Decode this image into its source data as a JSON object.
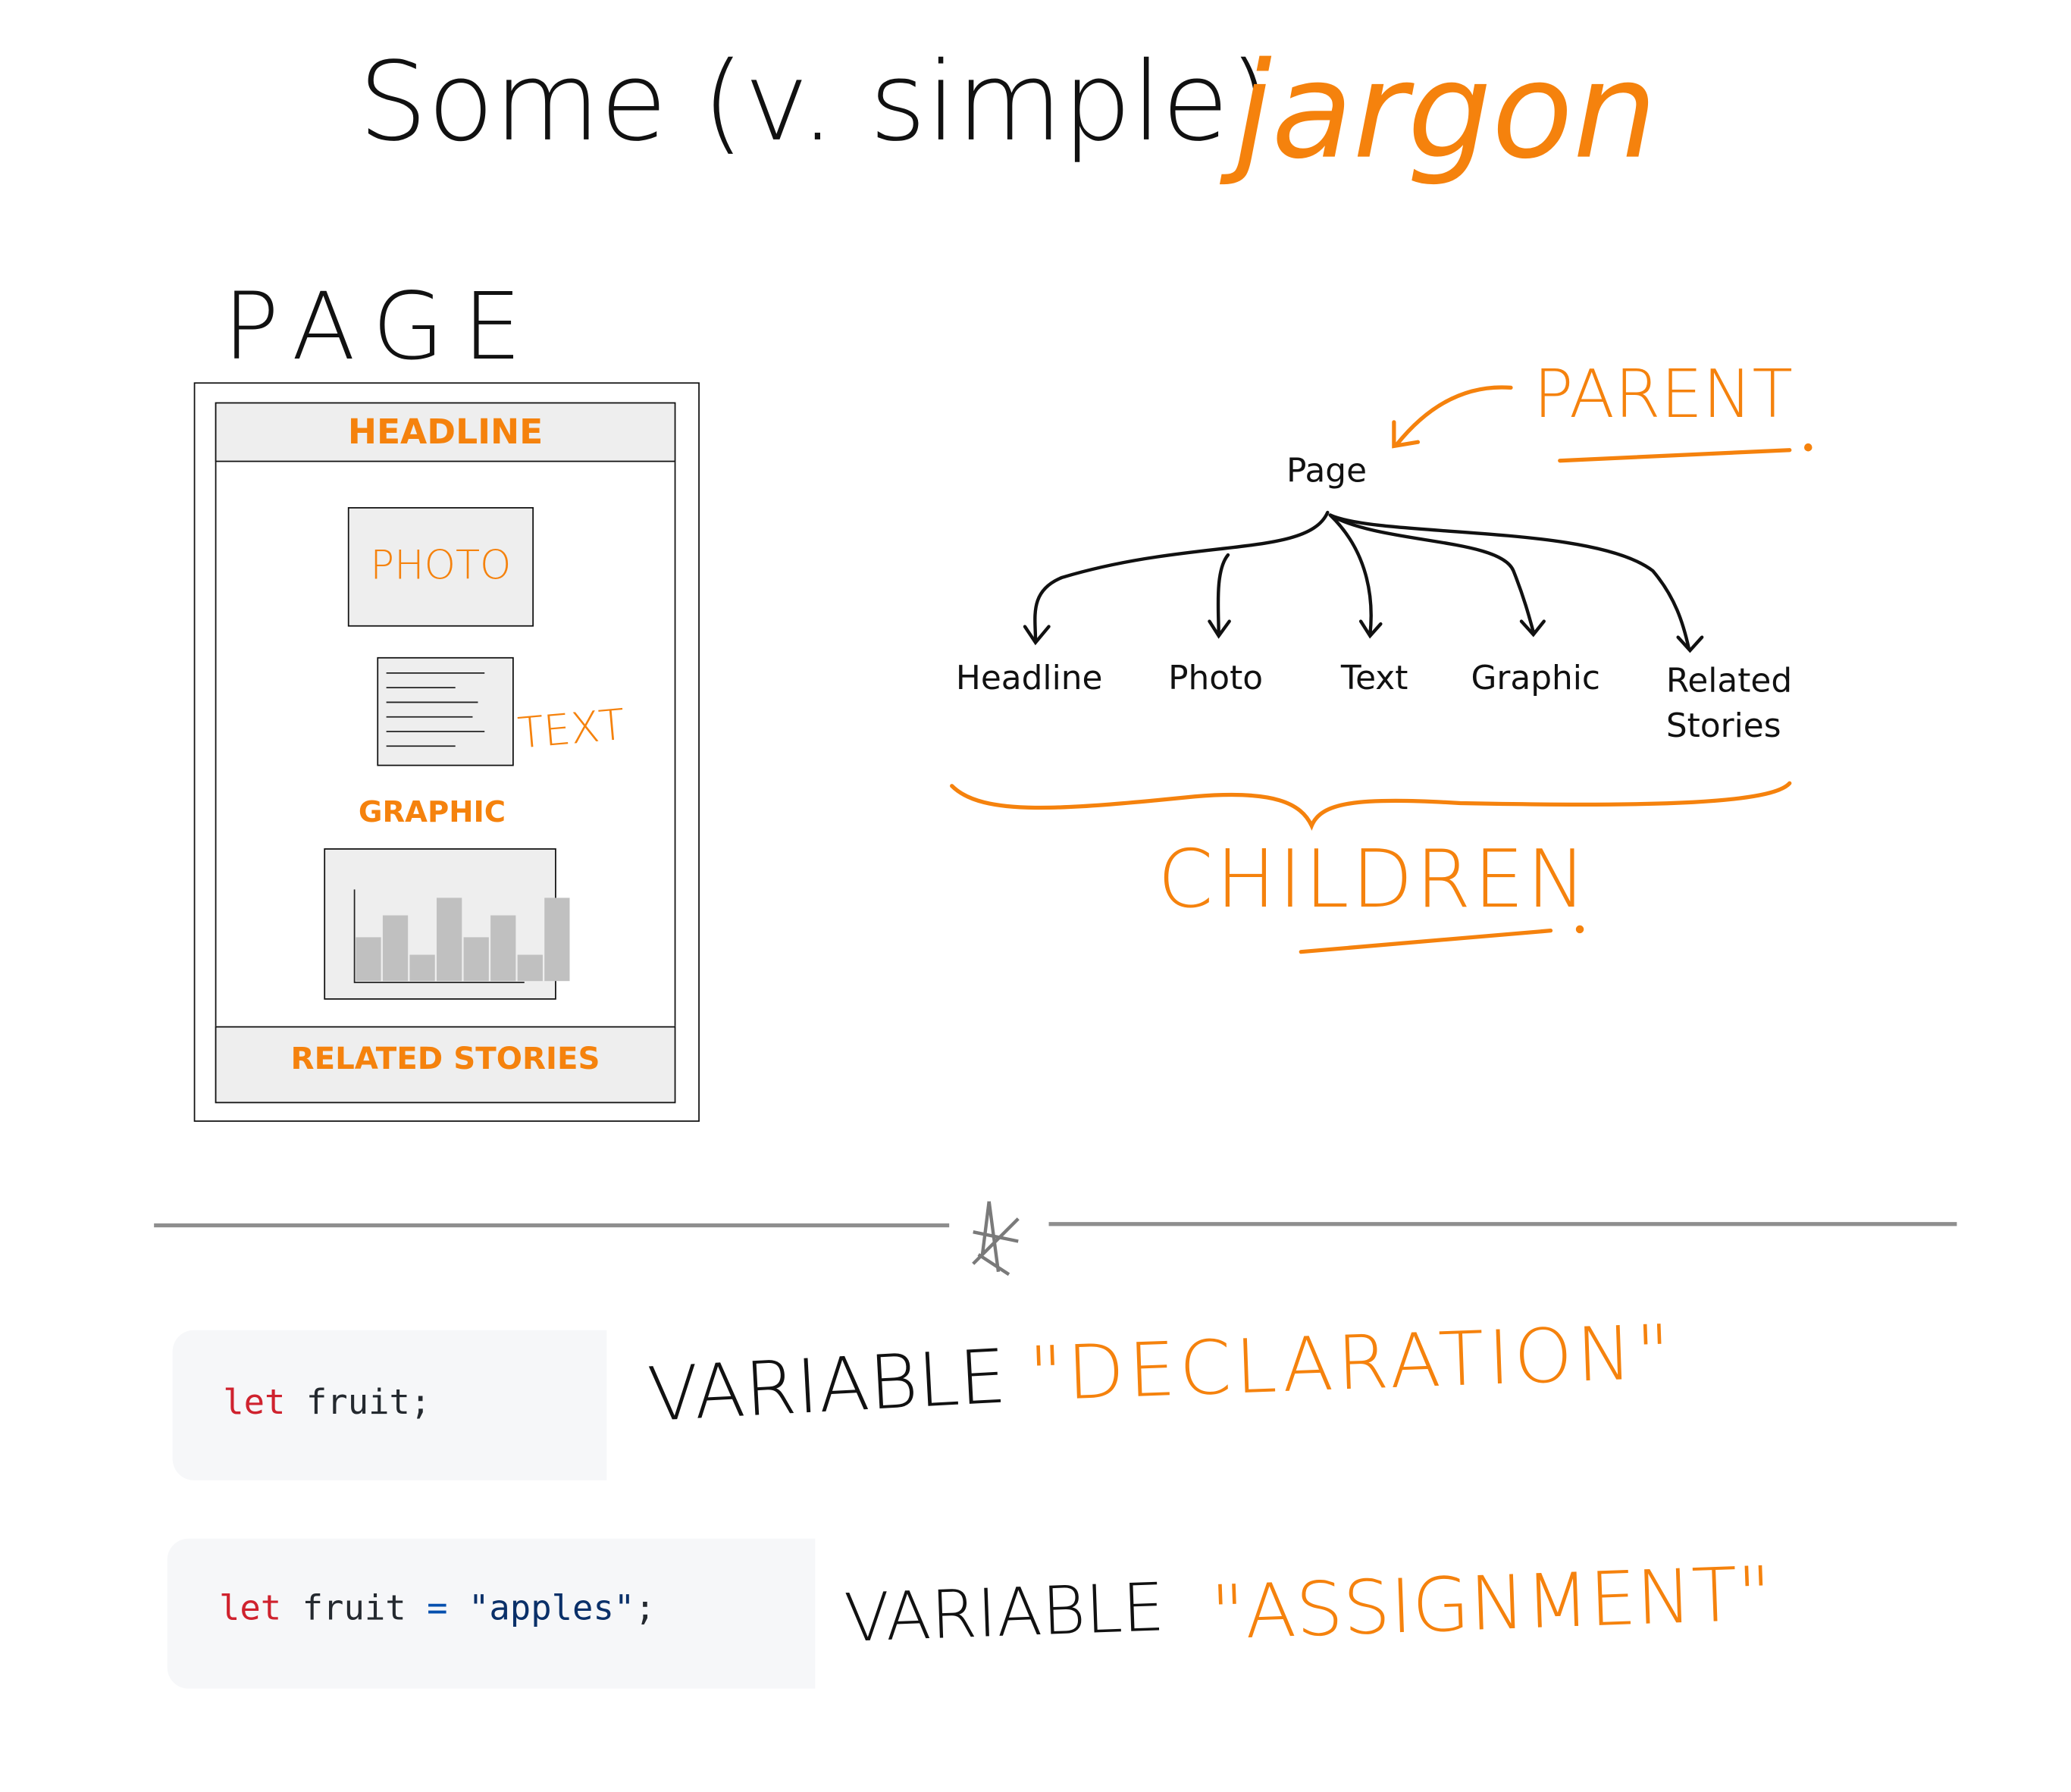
{
  "title": {
    "part1": "Some (v. simple)",
    "part2": "jargon"
  },
  "wireframe": {
    "label": "PAGE",
    "headline": "HEADLINE",
    "photo": "PHOTO",
    "text": "TEXT",
    "graphic": "GRAPHIC",
    "related": "RELATED STORIES",
    "bar_levels": [
      0.5,
      0.75,
      0.3,
      0.95,
      0.5,
      0.75,
      0.3,
      0.95
    ]
  },
  "tree": {
    "root": "Page",
    "parent_label": "PARENT",
    "children_label": "CHILDREN",
    "children": [
      "Headline",
      "Photo",
      "Text",
      "Graphic",
      "Related Stories"
    ]
  },
  "code": {
    "declaration": {
      "keyword": "let",
      "rest": " fruit;"
    },
    "assignment": {
      "keyword": "let",
      "name": " fruit ",
      "op": "=",
      "string": " \"apples\"",
      "end": ";"
    }
  },
  "notes": {
    "declaration": {
      "prefix": "VARIABLE",
      "term": "\"DECLARATION\""
    },
    "assignment": {
      "prefix": "VARIABLE",
      "term": "\"ASSIGNMENT\""
    }
  },
  "colors": {
    "accent": "#f5820d",
    "ink": "#111111",
    "code_bg": "#f6f7f9"
  }
}
